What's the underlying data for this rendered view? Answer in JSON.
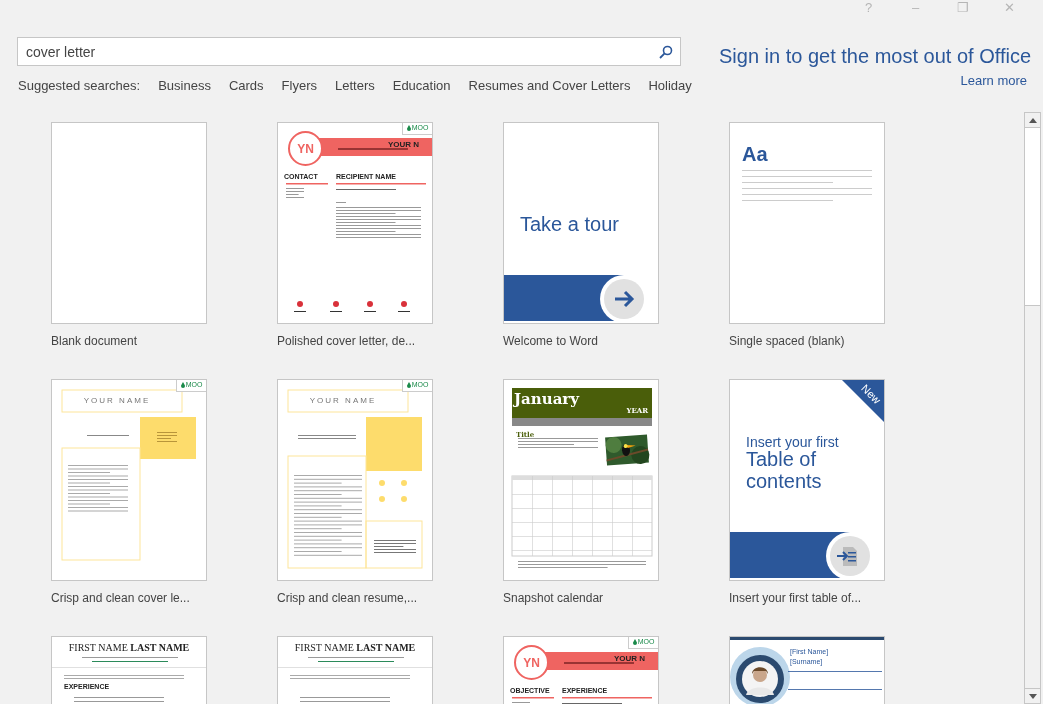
{
  "window_controls": [
    "?",
    "–",
    "❐",
    "✕"
  ],
  "search": {
    "value": "cover letter"
  },
  "suggested": {
    "label": "Suggested searches:",
    "items": [
      "Business",
      "Cards",
      "Flyers",
      "Letters",
      "Education",
      "Resumes and Cover Letters",
      "Holiday"
    ]
  },
  "sign_in": {
    "text": "Sign in to get the most out of Office",
    "link": "Learn more"
  },
  "templates": [
    {
      "kind": "blank",
      "label": "Blank document"
    },
    {
      "kind": "cover_red",
      "label": "Polished cover letter, de...",
      "initials": "YN",
      "name": "YOUR N",
      "badge": "MOO",
      "sections": [
        "CONTACT",
        "RECIPIENT NAME"
      ]
    },
    {
      "kind": "tour",
      "label": "Welcome to Word",
      "heading": "Take a tour"
    },
    {
      "kind": "aa",
      "label": "Single spaced (blank)",
      "heading": "Aa"
    },
    {
      "kind": "cover_yellow",
      "label": "Crisp and clean cover le...",
      "name": "YOUR NAME",
      "badge": "MOO"
    },
    {
      "kind": "resume_yellow",
      "label": "Crisp and clean resume,...",
      "name": "YOUR NAME",
      "badge": "MOO"
    },
    {
      "kind": "calendar",
      "label": "Snapshot calendar",
      "month": "January",
      "year": "YEAR",
      "title": "Title"
    },
    {
      "kind": "toc",
      "label": "Insert your first table of...",
      "line": "Insert your first",
      "heading": "Table of contents",
      "ribbon": "New"
    },
    {
      "kind": "classic",
      "name": "FIRST NAME **LAST NAME**",
      "sections": [
        "EXPERIENCE"
      ]
    },
    {
      "kind": "classic",
      "name": "FIRST NAME **LAST NAME**"
    },
    {
      "kind": "cover_red",
      "initials": "YN",
      "name": "YOUR N",
      "badge": "MOO",
      "sections": [
        "OBJECTIVE",
        "EXPERIENCE"
      ]
    },
    {
      "first": "[First Name]",
      "last": "[Surname]"
    }
  ]
}
